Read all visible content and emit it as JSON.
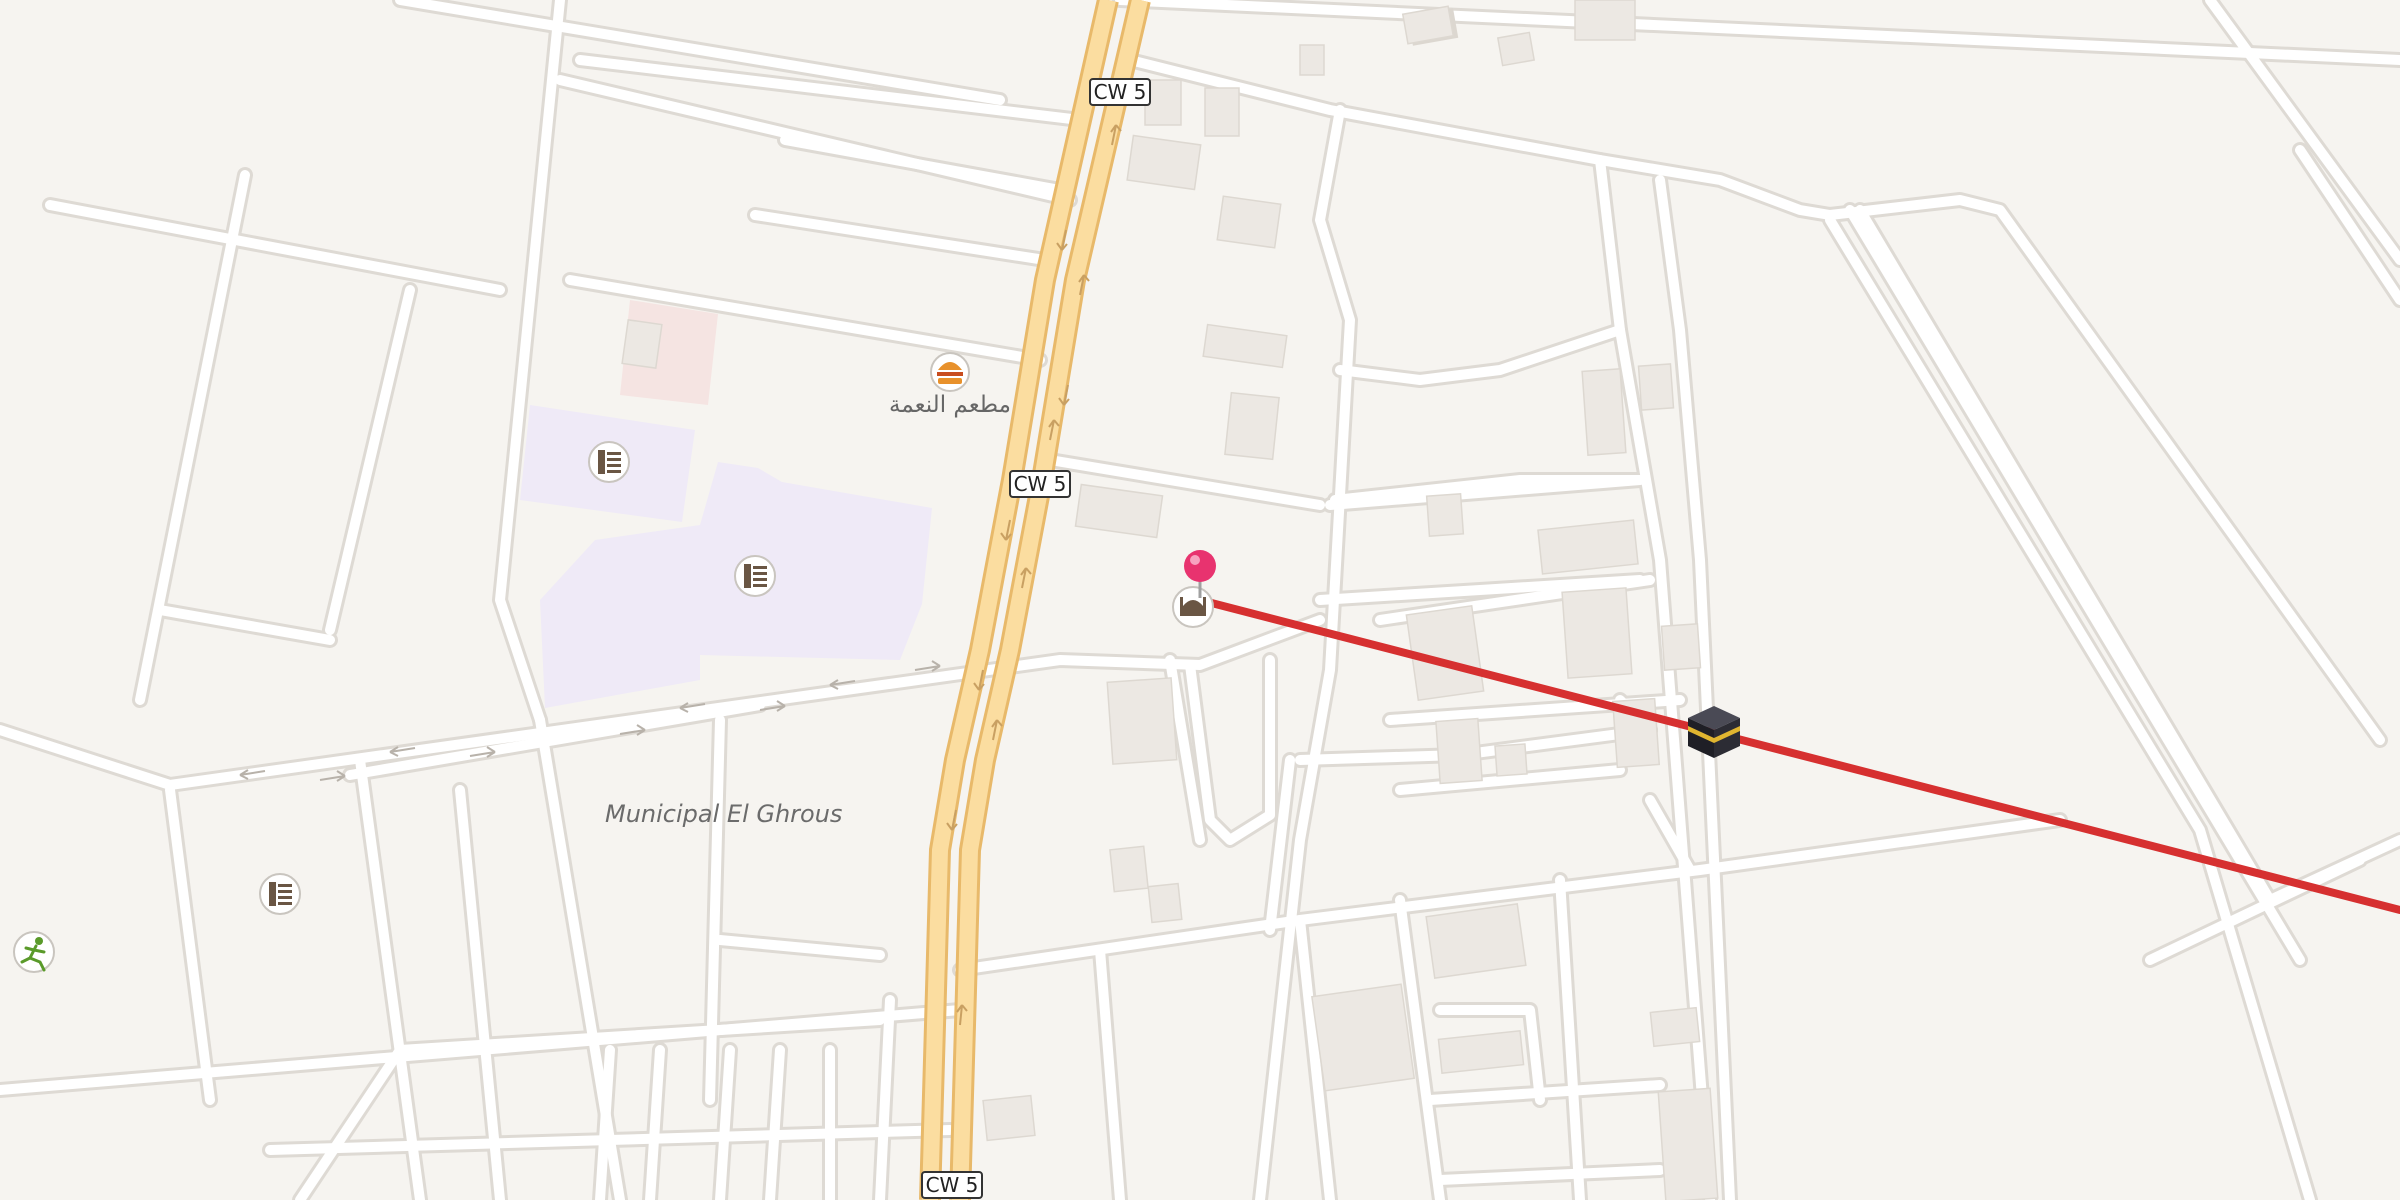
{
  "map": {
    "road_shields": [
      {
        "label": "CW 5"
      },
      {
        "label": "CW 5"
      },
      {
        "label": "CW 5"
      }
    ],
    "place_labels": [
      {
        "text": "Municipal El Ghrous"
      }
    ],
    "poi_labels": [
      {
        "text": "مطعم النعمة"
      }
    ],
    "poi_icons": [
      {
        "icon": "fast-food-icon"
      },
      {
        "icon": "school-icon"
      },
      {
        "icon": "school-icon"
      },
      {
        "icon": "school-icon"
      },
      {
        "icon": "mosque-icon"
      },
      {
        "icon": "sports-icon"
      },
      {
        "icon": "kaaba-icon"
      },
      {
        "icon": "location-pin-icon"
      }
    ],
    "colors": {
      "background": "#f6f4f0",
      "road": "#ffffff",
      "road_casing": "#dedad4",
      "highway_fill": "#fbdda0",
      "highway_casing": "#e8b96a",
      "building": "#ece8e3",
      "school_area": "#efeaf7",
      "qibla_line": "#d63030",
      "pin": "#e8336f"
    }
  }
}
